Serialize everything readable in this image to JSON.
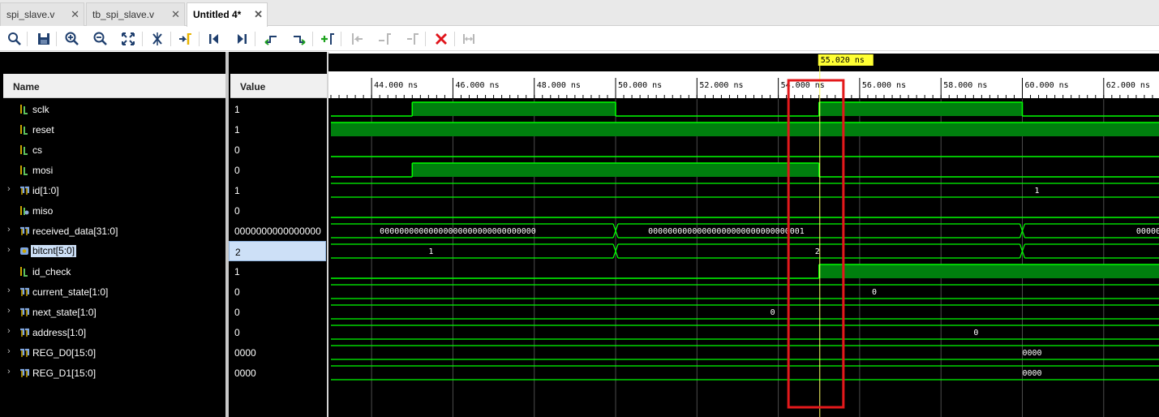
{
  "tabs": [
    {
      "label": "spi_slave.v",
      "active": false
    },
    {
      "label": "tb_spi_slave.v",
      "active": false
    },
    {
      "label": "Untitled 4*",
      "active": true
    }
  ],
  "toolbar": {
    "icons": [
      "search-icon",
      "save-icon",
      "zoom-in-icon",
      "zoom-out-icon",
      "zoom-fit-icon",
      "cursor-icon",
      "go-to-cursor-icon",
      "go-to-start-icon",
      "go-to-end-icon",
      "previous-transition-icon",
      "next-transition-icon",
      "add-marker-icon",
      "previous-marker-icon",
      "next-marker-icon",
      "delete-marker-icon",
      "swap-cursors-icon",
      "remove-markers-icon"
    ]
  },
  "columns": {
    "name": "Name",
    "value": "Value"
  },
  "cursor": {
    "label": "55.020 ns",
    "time": 55.02
  },
  "signals": [
    {
      "name": "sclk",
      "value": "1",
      "expandable": false,
      "kind": "bit"
    },
    {
      "name": "reset",
      "value": "1",
      "expandable": false,
      "kind": "bit"
    },
    {
      "name": "cs",
      "value": "0",
      "expandable": false,
      "kind": "bit"
    },
    {
      "name": "mosi",
      "value": "0",
      "expandable": false,
      "kind": "bit"
    },
    {
      "name": "id[1:0]",
      "value": "1",
      "expandable": true,
      "kind": "bus"
    },
    {
      "name": "miso",
      "value": "0",
      "expandable": false,
      "kind": "bit-out"
    },
    {
      "name": "received_data[31:0]",
      "value": "0000000000000000",
      "expandable": true,
      "kind": "bus"
    },
    {
      "name": "bitcnt[5:0]",
      "value": "2",
      "expandable": true,
      "kind": "bus-int",
      "selected": true
    },
    {
      "name": "id_check",
      "value": "1",
      "expandable": false,
      "kind": "bit"
    },
    {
      "name": "current_state[1:0]",
      "value": "0",
      "expandable": true,
      "kind": "bus"
    },
    {
      "name": "next_state[1:0]",
      "value": "0",
      "expandable": true,
      "kind": "bus"
    },
    {
      "name": "address[1:0]",
      "value": "0",
      "expandable": true,
      "kind": "bus"
    },
    {
      "name": "REG_D0[15:0]",
      "value": "0000",
      "expandable": true,
      "kind": "bus"
    },
    {
      "name": "REG_D1[15:0]",
      "value": "0000",
      "expandable": true,
      "kind": "bus"
    }
  ],
  "timeline": {
    "start_ns": 43.0,
    "end_ns": 63.4,
    "ticks": [
      "44.000 ns",
      "46.000 ns",
      "48.000 ns",
      "50.000 ns",
      "52.000 ns",
      "54.000 ns",
      "56.000 ns",
      "58.000 ns",
      "60.000 ns",
      "62.000 ns"
    ],
    "tick_values": [
      44,
      46,
      48,
      50,
      52,
      54,
      56,
      58,
      60,
      62
    ]
  },
  "waves": [
    {
      "type": "bit",
      "segments": [
        [
          43.0,
          45.0,
          0
        ],
        [
          45.0,
          50.0,
          1
        ],
        [
          50.0,
          55.0,
          0
        ],
        [
          55.0,
          60.0,
          1
        ],
        [
          60.0,
          63.4,
          0
        ]
      ]
    },
    {
      "type": "bit",
      "segments": [
        [
          43.0,
          63.4,
          1
        ]
      ]
    },
    {
      "type": "bit",
      "segments": [
        [
          43.0,
          63.4,
          0
        ]
      ]
    },
    {
      "type": "bit",
      "segments": [
        [
          43.0,
          45.0,
          0
        ],
        [
          45.0,
          55.0,
          1
        ],
        [
          55.0,
          63.4,
          0
        ]
      ]
    },
    {
      "type": "bus",
      "segments": [
        [
          43.0,
          63.4,
          "1",
          60.3
        ]
      ]
    },
    {
      "type": "bit",
      "segments": [
        [
          43.0,
          63.4,
          0
        ]
      ]
    },
    {
      "type": "bus",
      "segments": [
        [
          43.0,
          50.0,
          "00000000000000000000000000000000",
          44.2
        ],
        [
          50.0,
          60.0,
          "00000000000000000000000000000001",
          50.8
        ],
        [
          60.0,
          63.4,
          "00000",
          62.8
        ]
      ]
    },
    {
      "type": "bus",
      "segments": [
        [
          43.0,
          50.0,
          "1",
          45.4
        ],
        [
          50.0,
          60.0,
          "2",
          54.9
        ],
        [
          60.0,
          63.4,
          "",
          0
        ]
      ]
    },
    {
      "type": "bit",
      "segments": [
        [
          43.0,
          55.0,
          0
        ],
        [
          55.0,
          63.4,
          1
        ]
      ]
    },
    {
      "type": "bus",
      "segments": [
        [
          43.0,
          63.4,
          "0",
          56.3
        ]
      ]
    },
    {
      "type": "bus",
      "segments": [
        [
          43.0,
          63.4,
          "0",
          53.8
        ]
      ]
    },
    {
      "type": "bus",
      "segments": [
        [
          43.0,
          63.4,
          "0",
          58.8
        ]
      ]
    },
    {
      "type": "bus",
      "segments": [
        [
          43.0,
          63.4,
          "0000",
          60.0
        ]
      ]
    },
    {
      "type": "bus",
      "segments": [
        [
          43.0,
          63.4,
          "0000",
          60.0
        ]
      ]
    }
  ],
  "colors": {
    "wave": "#00ff00",
    "wave_fill": "#007f0e",
    "grid": "#4b4b4b",
    "cursor": "#ffff66",
    "highlight_box": "#e3191b",
    "cursor_label_bg": "#ffff33"
  }
}
